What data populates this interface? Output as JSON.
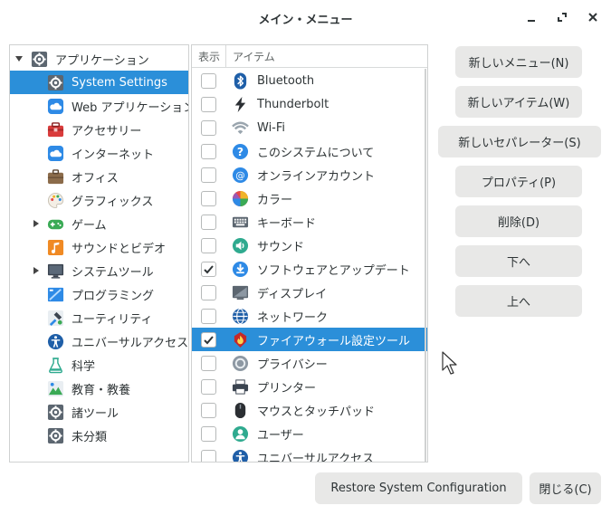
{
  "window": {
    "title": "メイン・メニュー"
  },
  "tree": {
    "items": [
      {
        "label": "アプリケーション",
        "icon": "gear-icon",
        "level": 0,
        "expander": "expanded",
        "selected": false
      },
      {
        "label": "System Settings",
        "icon": "gear-icon",
        "level": 1,
        "expander": "none",
        "selected": true
      },
      {
        "label": "Web アプリケーション",
        "icon": "cloud-icon",
        "level": 1,
        "expander": "none",
        "selected": false
      },
      {
        "label": "アクセサリー",
        "icon": "toolbox-icon",
        "level": 1,
        "expander": "none",
        "selected": false
      },
      {
        "label": "インターネット",
        "icon": "cloud-icon",
        "level": 1,
        "expander": "none",
        "selected": false
      },
      {
        "label": "オフィス",
        "icon": "briefcase-icon",
        "level": 1,
        "expander": "none",
        "selected": false
      },
      {
        "label": "グラフィックス",
        "icon": "palette-icon",
        "level": 1,
        "expander": "none",
        "selected": false
      },
      {
        "label": "ゲーム",
        "icon": "gamepad-icon",
        "level": 1,
        "expander": "collapsed",
        "selected": false
      },
      {
        "label": "サウンドとビデオ",
        "icon": "multimedia-icon",
        "level": 1,
        "expander": "none",
        "selected": false
      },
      {
        "label": "システムツール",
        "icon": "monitor-icon",
        "level": 1,
        "expander": "collapsed",
        "selected": false
      },
      {
        "label": "プログラミング",
        "icon": "programming-icon",
        "level": 1,
        "expander": "none",
        "selected": false
      },
      {
        "label": "ユーティリティ",
        "icon": "utilities-icon",
        "level": 1,
        "expander": "none",
        "selected": false
      },
      {
        "label": "ユニバーサルアクセス",
        "icon": "accessibility-icon",
        "level": 1,
        "expander": "none",
        "selected": false
      },
      {
        "label": "科学",
        "icon": "flask-icon",
        "level": 1,
        "expander": "none",
        "selected": false
      },
      {
        "label": "教育・教養",
        "icon": "education-icon",
        "level": 1,
        "expander": "none",
        "selected": false
      },
      {
        "label": "諸ツール",
        "icon": "gear-icon",
        "level": 1,
        "expander": "none",
        "selected": false
      },
      {
        "label": "未分類",
        "icon": "gear-icon",
        "level": 1,
        "expander": "none",
        "selected": false
      }
    ]
  },
  "items_table": {
    "col_show": "表示",
    "col_item": "アイテム",
    "rows": [
      {
        "label": "Bluetooth",
        "icon": "bluetooth-icon",
        "checked": false,
        "selected": false
      },
      {
        "label": "Thunderbolt",
        "icon": "thunderbolt-icon",
        "checked": false,
        "selected": false
      },
      {
        "label": "Wi-Fi",
        "icon": "wifi-icon",
        "checked": false,
        "selected": false
      },
      {
        "label": "このシステムについて",
        "icon": "help-icon",
        "checked": false,
        "selected": false
      },
      {
        "label": "オンラインアカウント",
        "icon": "at-icon",
        "checked": false,
        "selected": false
      },
      {
        "label": "カラー",
        "icon": "color-wheel-icon",
        "checked": false,
        "selected": false
      },
      {
        "label": "キーボード",
        "icon": "keyboard-icon",
        "checked": false,
        "selected": false
      },
      {
        "label": "サウンド",
        "icon": "speaker-icon",
        "checked": false,
        "selected": false
      },
      {
        "label": "ソフトウェアとアップデート",
        "icon": "download-icon",
        "checked": true,
        "selected": false
      },
      {
        "label": "ディスプレイ",
        "icon": "display-icon",
        "checked": false,
        "selected": false
      },
      {
        "label": "ネットワーク",
        "icon": "globe-icon",
        "checked": false,
        "selected": false
      },
      {
        "label": "ファイアウォール設定ツール",
        "icon": "firewall-icon",
        "checked": true,
        "selected": true
      },
      {
        "label": "プライバシー",
        "icon": "privacy-icon",
        "checked": false,
        "selected": false
      },
      {
        "label": "プリンター",
        "icon": "printer-icon",
        "checked": false,
        "selected": false
      },
      {
        "label": "マウスとタッチパッド",
        "icon": "mouse-icon",
        "checked": false,
        "selected": false
      },
      {
        "label": "ユーザー",
        "icon": "user-icon",
        "checked": false,
        "selected": false
      },
      {
        "label": "ユニバーサルアクセス",
        "icon": "accessibility-icon",
        "checked": false,
        "selected": false
      }
    ]
  },
  "buttons": {
    "new_menu": "新しいメニュー(N)",
    "new_item": "新しいアイテム(W)",
    "new_separator": "新しいセパレーター(S)",
    "properties": "プロパティ(P)",
    "delete": "削除(D)",
    "move_down": "下へ",
    "move_up": "上へ",
    "restore": "Restore System Configuration",
    "close": "閉じる(C)"
  },
  "colors": {
    "selection": "#2b8fd9",
    "button_bg": "#e8e8e7"
  }
}
